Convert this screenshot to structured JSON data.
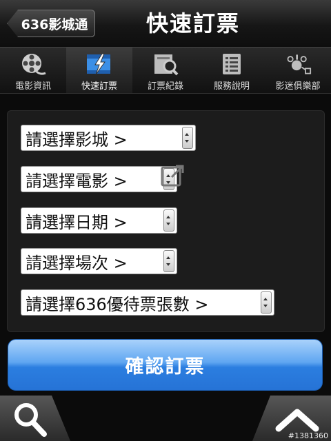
{
  "header": {
    "back_label": "636影城通",
    "title": "快速訂票"
  },
  "nav": {
    "items": [
      {
        "label": "電影資訊",
        "icon": "film-reel-icon",
        "active": false
      },
      {
        "label": "快速訂票",
        "icon": "quick-booking-icon",
        "active": true
      },
      {
        "label": "訂票紀錄",
        "icon": "booking-record-icon",
        "active": false
      },
      {
        "label": "服務說明",
        "icon": "service-info-icon",
        "active": false
      },
      {
        "label": "影迷俱樂部",
        "icon": "club-icon",
        "active": false
      }
    ]
  },
  "form": {
    "cinema": "請選擇影城 >",
    "movie": "請選擇電影 >",
    "date": "請選擇日期 >",
    "showtime": "請選擇場次 >",
    "ticket_count": "請選擇636優待票張數 >"
  },
  "confirm_label": "確認訂票",
  "watermark": "#1381360",
  "colors": {
    "background": "#0b0b0b",
    "confirm_blue": "#2b7ee0"
  }
}
